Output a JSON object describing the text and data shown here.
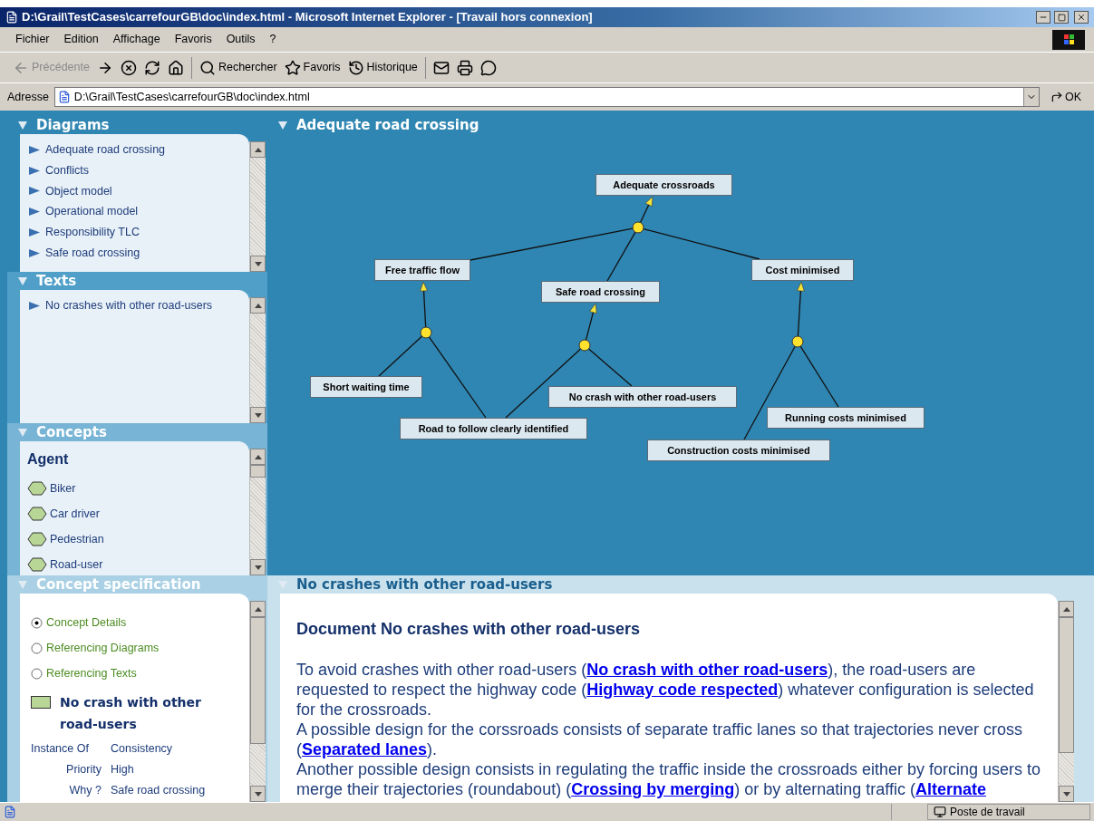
{
  "window": {
    "title": "D:\\Grail\\TestCases\\carrefourGB\\doc\\index.html - Microsoft Internet Explorer - [Travail hors connexion]"
  },
  "menu": [
    "Fichier",
    "Edition",
    "Affichage",
    "Favoris",
    "Outils",
    "?"
  ],
  "toolbar": [
    {
      "kind": "back",
      "label": "Précédente",
      "disabled": true
    },
    {
      "kind": "forward",
      "disabled": false
    },
    {
      "kind": "stop",
      "disabled": false
    },
    {
      "kind": "refresh",
      "disabled": false
    },
    {
      "kind": "home",
      "disabled": false
    },
    {
      "kind": "search",
      "label": "Rechercher",
      "disabled": false
    },
    {
      "kind": "favorites",
      "label": "Favoris",
      "disabled": false
    },
    {
      "kind": "history",
      "label": "Historique",
      "disabled": false
    },
    {
      "kind": "mail",
      "disabled": false
    },
    {
      "kind": "print",
      "disabled": false
    },
    {
      "kind": "discuss",
      "disabled": false
    }
  ],
  "address": {
    "label": "Adresse",
    "value": "D:\\Grail\\TestCases\\carrefourGB\\doc\\index.html",
    "go": "OK"
  },
  "sidebar": {
    "sections": [
      {
        "kind": "list",
        "title": "Diagrams",
        "items": [
          "Adequate road crossing",
          "Conflicts",
          "Object model",
          "Operational model",
          "Responsibility TLC",
          "Safe road crossing"
        ]
      },
      {
        "kind": "list",
        "title": "Texts",
        "items": [
          "No crashes with other road-users"
        ]
      },
      {
        "kind": "concepts",
        "title": "Concepts",
        "group": "Agent",
        "items": [
          "Biker",
          "Car driver",
          "Pedestrian",
          "Road-user"
        ]
      },
      {
        "kind": "spec",
        "title": "Concept specification",
        "options": [
          {
            "label": "Concept Details",
            "selected": true
          },
          {
            "label": "Referencing Diagrams",
            "selected": false
          },
          {
            "label": "Referencing Texts",
            "selected": false
          }
        ],
        "concept": "No crash with other road-users",
        "properties": [
          {
            "name": "Instance Of",
            "value": "Consistency"
          },
          {
            "name": "Priority",
            "value": "High"
          },
          {
            "name": "Why ?",
            "value": "Safe road crossing"
          }
        ]
      }
    ]
  },
  "diagram": {
    "title": "Adequate road crossing",
    "nodes": [
      "Adequate crossroads",
      "Free traffic flow",
      "Safe road crossing",
      "Cost minimised",
      "Short waiting time",
      "No crash with other road-users",
      "Road to follow clearly identified",
      "Running costs minimised",
      "Construction costs minimised"
    ]
  },
  "document": {
    "title": "No crashes with other road-users",
    "heading": "Document No crashes with other road-users",
    "paragraphs": [
      [
        {
          "kind": "text",
          "text": "To avoid crashes with other road-users ("
        },
        {
          "kind": "link",
          "text": "No crash with other road-users"
        },
        {
          "kind": "text",
          "text": "), the road-users are requested to respect the highway code ("
        },
        {
          "kind": "link",
          "text": "Highway code respected"
        },
        {
          "kind": "text",
          "text": ") whatever configuration is selected for the crossroads."
        }
      ],
      [
        {
          "kind": "text",
          "text": "A possible design for the corssroads consists of separate traffic lanes so that trajectories never cross ("
        },
        {
          "kind": "link",
          "text": "Separated lanes"
        },
        {
          "kind": "text",
          "text": ")."
        }
      ],
      [
        {
          "kind": "text",
          "text": "Another possible design consists in regulating the traffic inside the crossroads either by forcing users to merge their trajectories (roundabout) ("
        },
        {
          "kind": "link",
          "text": "Crossing by merging"
        },
        {
          "kind": "text",
          "text": ") or by alternating traffic ("
        },
        {
          "kind": "link",
          "text": "Alternate"
        }
      ]
    ]
  },
  "status_bar": {
    "zone": "Poste de travail"
  }
}
